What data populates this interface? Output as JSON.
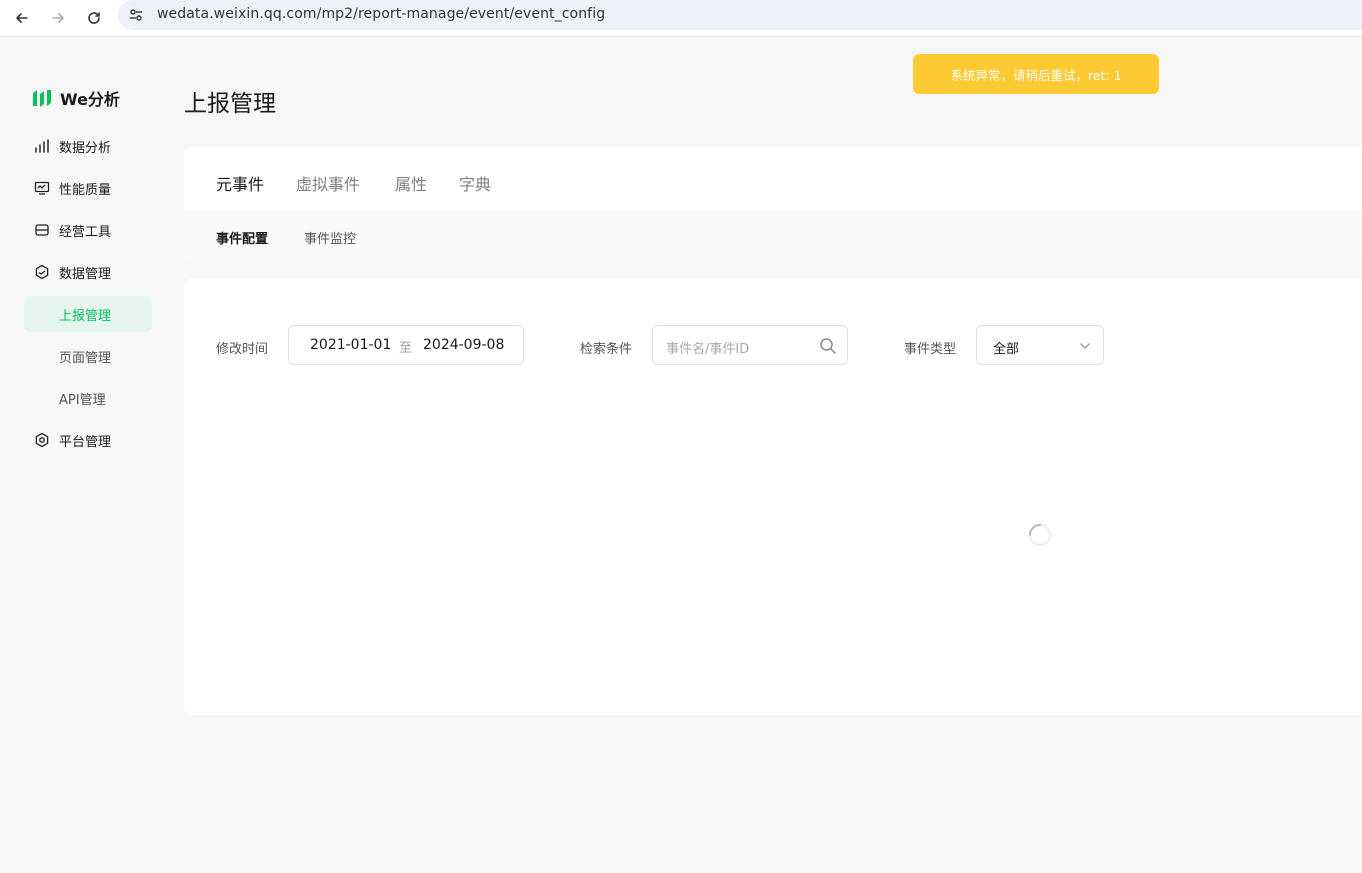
{
  "browser": {
    "url": "wedata.weixin.qq.com/mp2/report-manage/event/event_config"
  },
  "sidebar": {
    "logo_text": "We分析",
    "items": [
      {
        "label": "数据分析",
        "icon": "bar-chart-icon"
      },
      {
        "label": "性能质量",
        "icon": "monitor-icon"
      },
      {
        "label": "经营工具",
        "icon": "store-icon"
      },
      {
        "label": "数据管理",
        "icon": "data-manage-icon"
      },
      {
        "label": "上报管理",
        "sub": true,
        "active": true
      },
      {
        "label": "页面管理",
        "sub": true
      },
      {
        "label": "API管理",
        "sub": true
      },
      {
        "label": "平台管理",
        "icon": "hexagon-gear-icon"
      }
    ]
  },
  "main": {
    "title": "上报管理",
    "toast": "系统异常，请稍后重试，ret: 1",
    "tabs": [
      "元事件",
      "虚拟事件",
      "属性",
      "字典"
    ],
    "active_tab": "元事件",
    "subtabs": [
      "事件配置",
      "事件监控"
    ],
    "active_subtab": "事件配置",
    "filters": {
      "time_label": "修改时间",
      "date_start": "2021-01-01",
      "date_sep": "至",
      "date_end": "2024-09-08",
      "search_label": "检索条件",
      "search_placeholder": "事件名/事件ID",
      "type_label": "事件类型",
      "type_value": "全部"
    }
  },
  "colors": {
    "accent": "#07c160",
    "toast_bg": "#ffc933"
  }
}
